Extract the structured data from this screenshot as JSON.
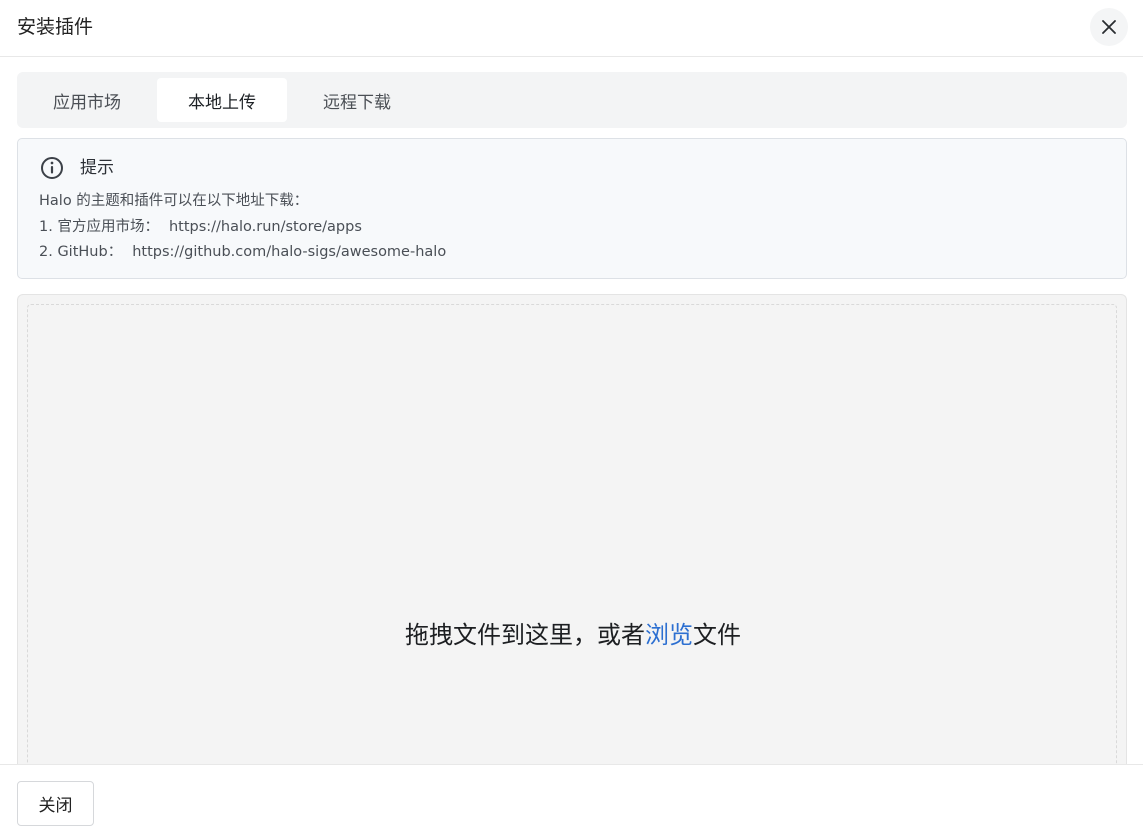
{
  "modal": {
    "title": "安装插件",
    "close_icon": "close-icon"
  },
  "tabs": [
    {
      "label": "应用市场",
      "active": false
    },
    {
      "label": "本地上传",
      "active": true
    },
    {
      "label": "远程下载",
      "active": false
    }
  ],
  "alert": {
    "icon": "info-icon",
    "title": "提示",
    "intro": "Halo 的主题和插件可以在以下地址下载：",
    "links": [
      {
        "label": "1. 官方应用市场：",
        "url": "https://halo.run/store/apps"
      },
      {
        "label": "2. GitHub：",
        "url": "https://github.com/halo-sigs/awesome-halo"
      }
    ]
  },
  "dropzone": {
    "text_before": "拖拽文件到这里，或者",
    "browse_label": "浏览",
    "text_after": "文件"
  },
  "footer": {
    "close_label": "关闭"
  },
  "colors": {
    "link": "#2c6fd1",
    "tabs_bg": "#f3f4f5",
    "alert_bg": "#f7f9fb",
    "dropzone_bg": "#f4f4f4"
  }
}
